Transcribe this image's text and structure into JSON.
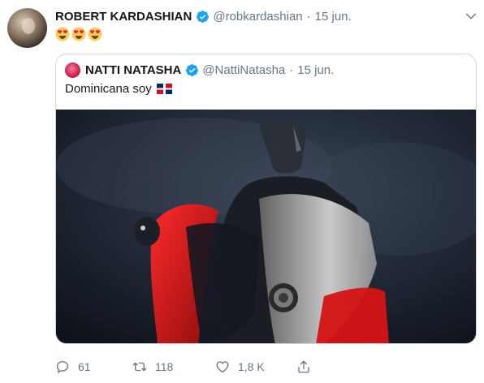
{
  "tweet": {
    "author_name": "ROBERT KARDASHIAN",
    "author_handle": "@robkardashian",
    "separator": "·",
    "date": "15 jun.",
    "text_emojis": [
      "smiling-face-with-heart-eyes",
      "smiling-face-with-heart-eyes",
      "smiling-face-with-heart-eyes"
    ]
  },
  "quoted_tweet": {
    "author_name": "NATTI NATASHA",
    "author_handle": "@NattiNatasha",
    "separator": "·",
    "date": "15 jun.",
    "text": "Dominicana soy",
    "text_emoji": "dominican-republic-flag"
  },
  "actions": {
    "reply_count": "61",
    "retweet_count": "118",
    "like_count": "1,8 K"
  },
  "colors": {
    "verified_blue": "#1da1f2",
    "muted_text": "#657786",
    "border": "#ccd6dd",
    "flag_red": "#ce1126",
    "flag_blue": "#002d62"
  },
  "icons": [
    "verified-badge-icon",
    "caret-down-icon",
    "reply-icon",
    "retweet-icon",
    "like-icon",
    "share-icon"
  ]
}
